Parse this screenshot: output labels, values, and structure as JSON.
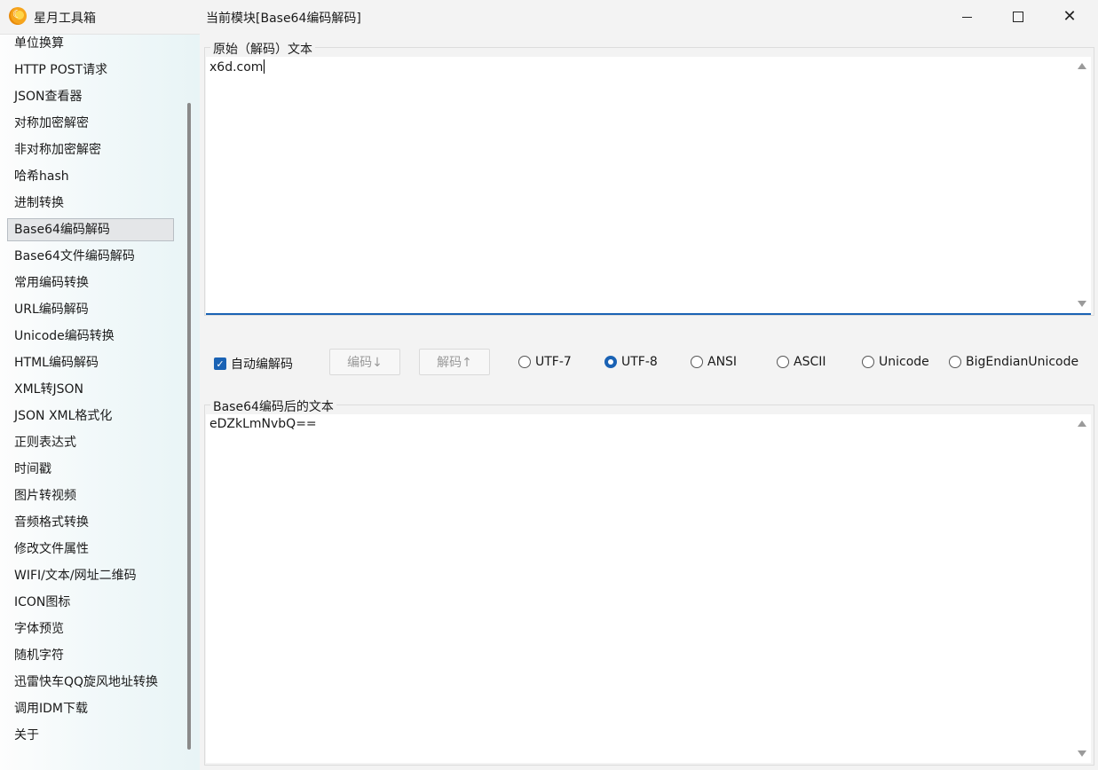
{
  "window": {
    "app_title": "星月工具箱",
    "module_title": "当前模块[Base64编码解码]"
  },
  "sidebar": {
    "items": [
      {
        "label": "单位换算"
      },
      {
        "label": "HTTP POST请求"
      },
      {
        "label": "JSON查看器"
      },
      {
        "label": "对称加密解密"
      },
      {
        "label": "非对称加密解密"
      },
      {
        "label": "哈希hash"
      },
      {
        "label": "进制转换"
      },
      {
        "label": "Base64编码解码",
        "selected": true
      },
      {
        "label": "Base64文件编码解码"
      },
      {
        "label": "常用编码转换"
      },
      {
        "label": "URL编码解码"
      },
      {
        "label": "Unicode编码转换"
      },
      {
        "label": "HTML编码解码"
      },
      {
        "label": "XML转JSON"
      },
      {
        "label": "JSON XML格式化"
      },
      {
        "label": "正则表达式"
      },
      {
        "label": "时间戳"
      },
      {
        "label": "图片转视频"
      },
      {
        "label": "音频格式转换"
      },
      {
        "label": "修改文件属性"
      },
      {
        "label": "WIFI/文本/网址二维码"
      },
      {
        "label": "ICON图标"
      },
      {
        "label": "字体预览"
      },
      {
        "label": "随机字符"
      },
      {
        "label": "迅雷快车QQ旋风地址转换"
      },
      {
        "label": "调用IDM下载"
      },
      {
        "label": "关于"
      }
    ]
  },
  "input_group": {
    "legend": "原始（解码）文本",
    "value": "x6d.com"
  },
  "controls": {
    "auto_label": "自动编解码",
    "auto_checked": true,
    "encode_label": "编码↓",
    "decode_label": "解码↑",
    "encodings": [
      {
        "label": "UTF-7",
        "checked": false
      },
      {
        "label": "UTF-8",
        "checked": true
      },
      {
        "label": "ANSI",
        "checked": false
      },
      {
        "label": "ASCII",
        "checked": false
      },
      {
        "label": "Unicode",
        "checked": false
      },
      {
        "label": "BigEndianUnicode",
        "checked": false
      }
    ]
  },
  "output_group": {
    "legend": "Base64编码后的文本",
    "value": "eDZkLmNvbQ=="
  },
  "colors": {
    "accent": "#1a62b4"
  }
}
